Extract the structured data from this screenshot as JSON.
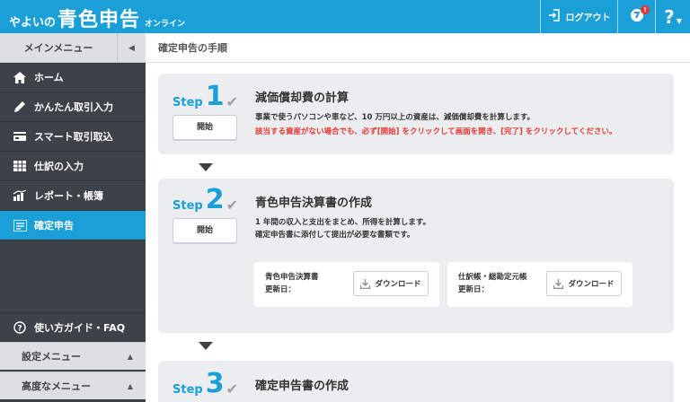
{
  "header": {
    "logo_small": "やよいの",
    "logo_big": "青色申告",
    "logo_sub": "オンライン",
    "logout_label": "ログアウト",
    "notification_badge": "!",
    "help_label": "?"
  },
  "sidebar": {
    "menu_title": "メインメニュー",
    "items": [
      {
        "label": "ホーム",
        "icon": "home-icon"
      },
      {
        "label": "かんたん取引入力",
        "icon": "pen-icon"
      },
      {
        "label": "スマート取引取込",
        "icon": "card-icon"
      },
      {
        "label": "仕訳の入力",
        "icon": "ledger-icon"
      },
      {
        "label": "レポート・帳簿",
        "icon": "chart-icon"
      },
      {
        "label": "確定申告",
        "icon": "document-icon"
      }
    ],
    "faq_label": "使い方ガイド・FAQ",
    "settings_label": "設定メニュー",
    "advanced_label": "高度なメニュー"
  },
  "main": {
    "page_title": "確定申告の手順",
    "step_word": "Step",
    "step1": {
      "num": "1",
      "title": "減価償却費の計算",
      "start_label": "開始",
      "desc": "事業で使うパソコンや車など、10 万円以上の資産は、減価償却費を計算します。",
      "warning": "該当する資産がない場合でも、必ず[開始] をクリックして画面を開き、[完了] をクリックしてください。"
    },
    "step2": {
      "num": "2",
      "title": "青色申告決算書の作成",
      "start_label": "開始",
      "desc_line1": "1 年間の収入と支出をまとめ、所得を計算します。",
      "desc_line2": "確定申告書に添付して提出が必要な書類です。",
      "downloads": [
        {
          "name": "青色申告決算書",
          "updated": "更新日：",
          "button": "ダウンロード"
        },
        {
          "name": "仕訳帳・総勘定元帳",
          "updated": "更新日：",
          "button": "ダウンロード"
        }
      ]
    },
    "step3": {
      "num": "3",
      "title": "確定申告書の作成"
    }
  },
  "colors": {
    "accent": "#1a9fd9",
    "sidebar_bg": "#3d4148",
    "warning": "#e53935",
    "card_bg": "#ecedef"
  }
}
